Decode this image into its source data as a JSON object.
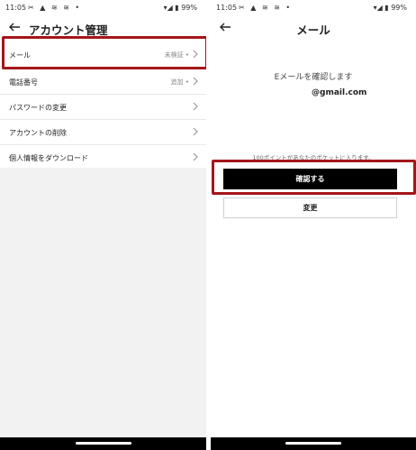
{
  "status_bar": {
    "time": "11:05",
    "left_icons": "✂ ▲ ≋ ≋ •",
    "right": "▾◢ ▮ 99%"
  },
  "account_screen": {
    "title": "アカウント管理",
    "items": [
      {
        "label": "メール",
        "status": "未検証"
      },
      {
        "label": "電話番号",
        "status": "追加"
      },
      {
        "label": "パスワードの変更",
        "status": ""
      },
      {
        "label": "アカウントの削除",
        "status": ""
      },
      {
        "label": "個人情報をダウンロード",
        "status": ""
      }
    ]
  },
  "email_screen": {
    "title": "メール",
    "verify_text": "Eメールを確認します",
    "email": "@gmail.com",
    "points_text": "100ポイントがあなたのポケットに入ります。",
    "confirm_button": "確認する",
    "change_button": "変更"
  },
  "colors": {
    "highlight": "#a4161a",
    "primary_button": "#000000"
  },
  "icons": [
    "back-arrow-icon",
    "chevron-right-icon",
    "status-dot-icon"
  ]
}
